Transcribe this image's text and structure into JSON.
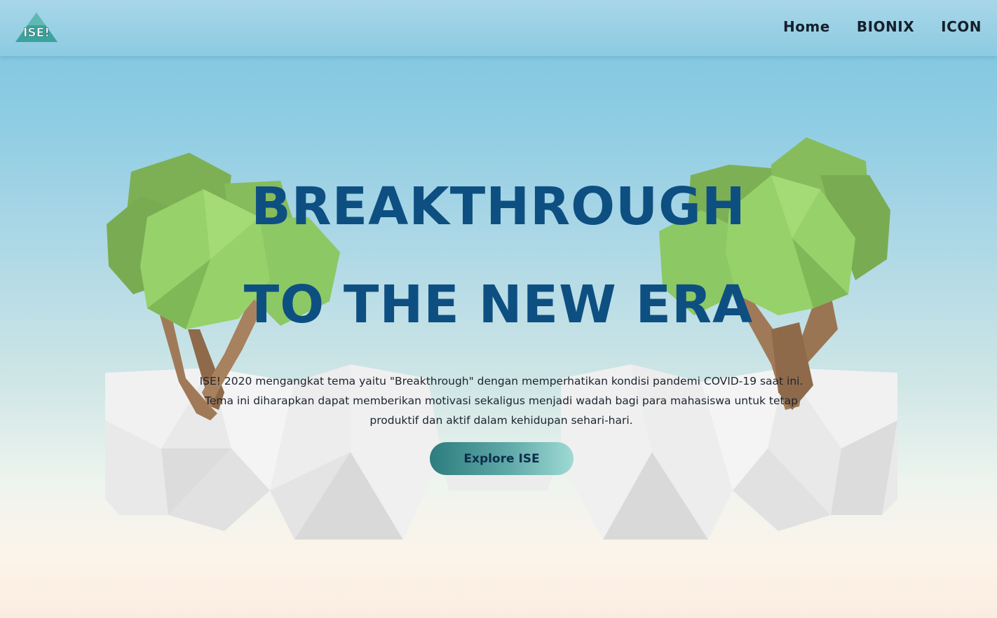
{
  "brand": {
    "logo_text": "ISE!"
  },
  "nav": {
    "links": [
      {
        "label": "Home"
      },
      {
        "label": "BIONIX"
      },
      {
        "label": "ICON"
      }
    ]
  },
  "hero": {
    "title_line1": "BREAKTHROUGH",
    "title_line2": "TO THE NEW ERA",
    "description": "ISE! 2020 mengangkat tema yaitu \"Breakthrough\" dengan memperhatikan kondisi pandemi COVID-19 saat ini. Tema ini diharapkan dapat memberikan motivasi sekaligus menjadi wadah bagi para mahasiswa untuk tetap produktif dan aktif dalam kehidupan sehari-hari.",
    "cta_label": "Explore ISE"
  },
  "colors": {
    "title": "#0e4f82",
    "sky_top": "#7cc4df",
    "ground": "#fbece0",
    "foliage": "#8cc864",
    "trunk": "#a07a58",
    "rock": "#e6e6e6"
  },
  "illustration": {
    "icons": [
      "tree-left-icon",
      "tree-right-icon",
      "rock-platform-icon"
    ]
  }
}
